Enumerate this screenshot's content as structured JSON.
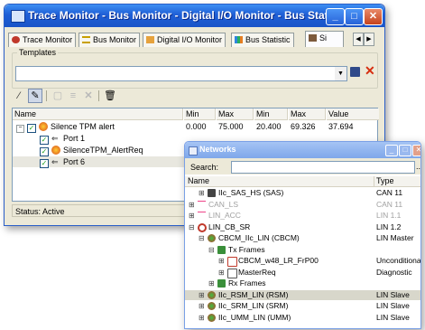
{
  "main_window": {
    "title": "Trace Monitor - Bus Monitor - Digital I/O Monitor - Bus Stati...",
    "caption_buttons": {
      "minimize": "_",
      "maximize": "□",
      "close": "✕"
    },
    "tabs": [
      {
        "label": "Trace Monitor",
        "icon": "trace-icon"
      },
      {
        "label": "Bus Monitor",
        "icon": "bus-icon"
      },
      {
        "label": "Digital I/O Monitor",
        "icon": "digital-io-icon"
      },
      {
        "label": "Bus Statistic",
        "icon": "statistic-icon"
      },
      {
        "label": "Si",
        "icon": "signal-icon",
        "active": true
      }
    ],
    "templates": {
      "label": "Templates",
      "value": ""
    },
    "columns": {
      "name": "Name",
      "min1": "Min",
      "max1": "Max",
      "min2": "Min",
      "max2": "Max",
      "value": "Value"
    },
    "rows": [
      {
        "name": "Silence TPM alert",
        "min1": "0.000",
        "max1": "75.000",
        "min2": "20.400",
        "max2": "69.326",
        "value": "37.694"
      },
      {
        "name": "Port 1"
      },
      {
        "name": "SilenceTPM_AlertReq"
      },
      {
        "name": "Port 6"
      }
    ],
    "status": "Status: Active"
  },
  "networks_window": {
    "title": "Networks",
    "search_label": "Search:",
    "search_value": "",
    "more": "...",
    "columns": {
      "name": "Name",
      "type": "Type"
    },
    "nodes": [
      {
        "name": "IIc_SAS_HS (SAS)",
        "type": "CAN 11",
        "indent": 1,
        "grey": false
      },
      {
        "name": "CAN_LS",
        "type": "CAN 11",
        "indent": 0,
        "grey": true
      },
      {
        "name": "LIN_ACC",
        "type": "LIN 1.1",
        "indent": 0,
        "grey": true
      },
      {
        "name": "LIN_CB_SR",
        "type": "LIN 1.2",
        "indent": 0,
        "grey": false
      },
      {
        "name": "CBCM_IIc_LIN (CBCM)",
        "type": "LIN Master",
        "indent": 1,
        "grey": false
      },
      {
        "name": "Tx Frames",
        "type": "",
        "indent": 2,
        "grey": false
      },
      {
        "name": "CBCM_w48_LR_FrP00",
        "type": "Unconditional",
        "indent": 3,
        "grey": false
      },
      {
        "name": "MasterReq",
        "type": "Diagnostic",
        "indent": 3,
        "grey": false
      },
      {
        "name": "Rx Frames",
        "type": "",
        "indent": 2,
        "grey": false
      },
      {
        "name": "IIc_RSM_LIN (RSM)",
        "type": "LIN Slave",
        "indent": 1,
        "grey": false
      },
      {
        "name": "IIc_SRM_LIN (SRM)",
        "type": "LIN Slave",
        "indent": 1,
        "grey": false
      },
      {
        "name": "IIc_UMM_LIN (UMM)",
        "type": "LIN Slave",
        "indent": 1,
        "grey": false
      }
    ]
  }
}
